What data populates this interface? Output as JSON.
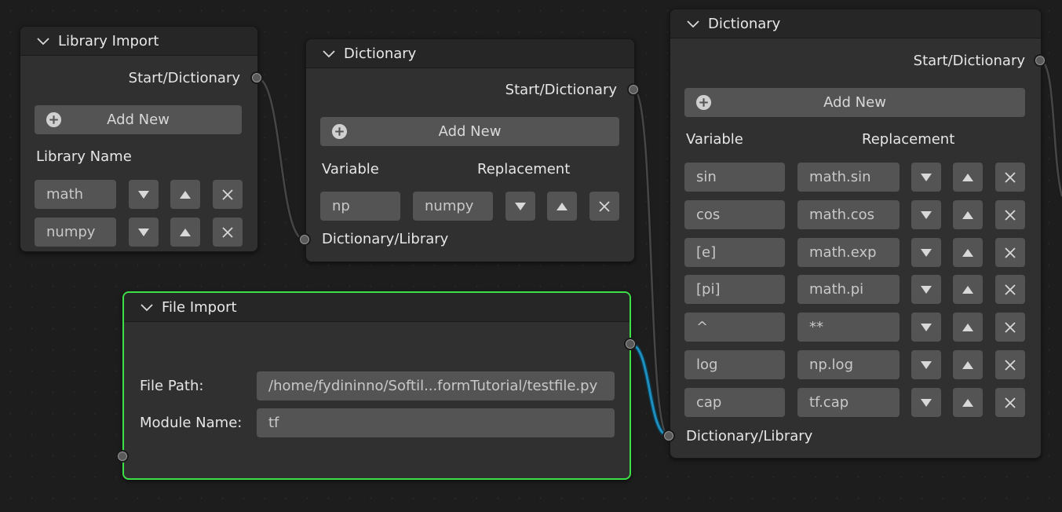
{
  "nodes": {
    "lib_import": {
      "title": "Library Import",
      "output_label": "Start/Dictionary",
      "add_new": "Add New",
      "column_label": "Library Name",
      "items": [
        "math",
        "numpy"
      ]
    },
    "dict_small": {
      "title": "Dictionary",
      "output_label": "Start/Dictionary",
      "add_new": "Add New",
      "col_variable": "Variable",
      "col_replacement": "Replacement",
      "rows": [
        {
          "variable": "np",
          "replacement": "numpy"
        }
      ],
      "input_label": "Dictionary/Library"
    },
    "file_import": {
      "title": "File Import",
      "file_path_label": "File Path:",
      "file_path_value": "/home/fydininno/Softil...formTutorial/testfile.py",
      "module_name_label": "Module Name:",
      "module_name_value": "tf"
    },
    "dict_large": {
      "title": "Dictionary",
      "output_label": "Start/Dictionary",
      "add_new": "Add New",
      "col_variable": "Variable",
      "col_replacement": "Replacement",
      "rows": [
        {
          "variable": "sin",
          "replacement": "math.sin"
        },
        {
          "variable": "cos",
          "replacement": "math.cos"
        },
        {
          "variable": "[e]",
          "replacement": "math.exp"
        },
        {
          "variable": "[pi]",
          "replacement": "math.pi"
        },
        {
          "variable": "^",
          "replacement": "**"
        },
        {
          "variable": "log",
          "replacement": "np.log"
        },
        {
          "variable": "cap",
          "replacement": "tf.cap"
        }
      ],
      "input_label": "Dictionary/Library"
    }
  },
  "colors": {
    "selected_outline": "#3ee047",
    "highlight_link": "#1e8fbf",
    "node_body": "#303030",
    "node_header": "#262626",
    "widget": "#545454"
  },
  "icons": [
    "chevron-down-icon",
    "plus-circle-icon",
    "triangle-down-icon",
    "triangle-up-icon",
    "close-icon"
  ]
}
